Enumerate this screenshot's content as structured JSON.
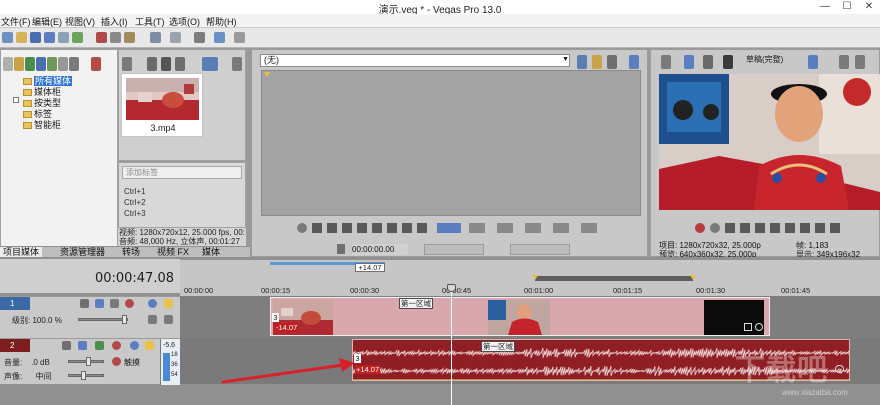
{
  "app": {
    "title": "演示.veg * - Vegas Pro 13.0",
    "window_controls": {
      "minimize": "—",
      "maximize": "☐",
      "close": "✕"
    }
  },
  "menu": [
    "文件(F)",
    "编辑(E)",
    "视图(V)",
    "插入(I)",
    "工具(T)",
    "选项(O)",
    "帮助(H)"
  ],
  "explorer": {
    "tree": [
      "所有媒体",
      "媒体柜",
      "按类型",
      "标签",
      "智能柜"
    ],
    "selected_index": 0,
    "media_file": "3.mp4",
    "tag_placeholder": "添加标签",
    "shortcuts": [
      "Ctrl+1",
      "Ctrl+2",
      "Ctrl+3"
    ],
    "info_line1": "视频: 1280x720x12, 25.000 fps, 00:",
    "info_line2": "音频: 48,000 Hz, 立体声, 00:01:27"
  },
  "left_tabs": [
    "项目媒体",
    "资源管理器",
    "转场",
    "视频 FX",
    "媒体"
  ],
  "left_tab_active": 0,
  "trimmer": {
    "select_value": "(无)",
    "timecode": "00:00:00.00"
  },
  "preview": {
    "quality": "草稿(完整)",
    "project_label": "项目:",
    "project_value": "1280x720x32, 25.000p",
    "frame_label": "帧:",
    "frame_value": "1,183",
    "preview_label": "预览:",
    "preview_value": "640x360x32, 25.000p",
    "display_label": "显示:",
    "display_value": "349x196x32"
  },
  "timeline": {
    "current_time": "00:00:47.08",
    "loop_length": "+14.07",
    "ruler_labels": [
      "00:00:00",
      "00:00:15",
      "00:00:30",
      "00:00:45",
      "00:01:00",
      "00:01:15",
      "00:01:30",
      "00:01:45"
    ],
    "video_track": {
      "number": "1",
      "level_label": "级别:",
      "level_value": "100.0 %",
      "region_flag": "第一区域",
      "offset": "-14.07",
      "take": "3"
    },
    "audio_track": {
      "number": "2",
      "volume_label": "音量:",
      "volume_value": ".0 dB",
      "pan_label": "声像:",
      "pan_value": "中间",
      "mode": "触摸",
      "meter_top": "-5.6",
      "meter_vals": [
        "18",
        "36",
        "54"
      ],
      "region_flag": "第一区域",
      "offset": "+14.07",
      "take": "3"
    }
  },
  "watermark": {
    "text": "下载吧",
    "url": "www.xiazaiba.com"
  },
  "colors": {
    "video_track_accent": "#3b6aa6",
    "audio_track_accent": "#7d1d1d",
    "video_event_fill": "#d9a8ac",
    "audio_event_fill": "#8f1f24",
    "arrow": "#d8202a"
  }
}
